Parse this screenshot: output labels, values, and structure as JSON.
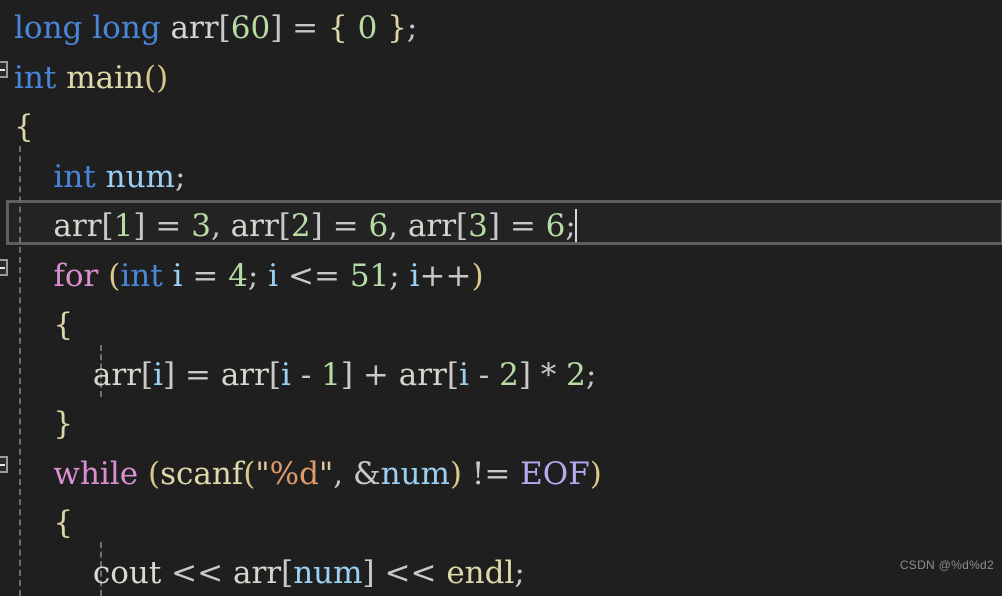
{
  "editor": {
    "theme": "visual-studio-dark",
    "background_color": "#1f1f1f",
    "current_line_border_color": "#5f5f5f",
    "indent_guide_color": "#6e6e6e",
    "caret_color": "#d8d8d8",
    "language": "cpp"
  },
  "watermark": {
    "text": "CSDN @%d%d2"
  },
  "fold_markers": [
    {
      "name": "fold-marker-main",
      "state": "expanded",
      "glyph": "minus"
    },
    {
      "name": "fold-marker-for",
      "state": "expanded",
      "glyph": "minus"
    },
    {
      "name": "fold-marker-while",
      "state": "expanded",
      "glyph": "minus"
    }
  ],
  "code": {
    "lines": [
      {
        "id": "line-1",
        "text": "long long arr[60] = { 0 };",
        "current": false,
        "tokens": [
          {
            "t": "long",
            "c": "t-kw"
          },
          {
            "t": " ",
            "c": "t-plain"
          },
          {
            "t": "long",
            "c": "t-kw"
          },
          {
            "t": " ",
            "c": "t-plain"
          },
          {
            "t": "arr",
            "c": "t-ident"
          },
          {
            "t": "[",
            "c": "t-bracket"
          },
          {
            "t": "60",
            "c": "t-num"
          },
          {
            "t": "]",
            "c": "t-bracket"
          },
          {
            "t": " ",
            "c": "t-plain"
          },
          {
            "t": "=",
            "c": "t-op"
          },
          {
            "t": " ",
            "c": "t-plain"
          },
          {
            "t": "{",
            "c": "t-brace"
          },
          {
            "t": " ",
            "c": "t-plain"
          },
          {
            "t": "0",
            "c": "t-num"
          },
          {
            "t": " ",
            "c": "t-plain"
          },
          {
            "t": "}",
            "c": "t-brace"
          },
          {
            "t": ";",
            "c": "t-punct"
          }
        ]
      },
      {
        "id": "line-2",
        "text": "int main()",
        "current": false,
        "tokens": [
          {
            "t": "int",
            "c": "t-kw"
          },
          {
            "t": " ",
            "c": "t-plain"
          },
          {
            "t": "main",
            "c": "t-func"
          },
          {
            "t": "(",
            "c": "t-paren"
          },
          {
            "t": ")",
            "c": "t-paren"
          }
        ]
      },
      {
        "id": "line-3",
        "text": "{",
        "current": false,
        "tokens": [
          {
            "t": "{",
            "c": "t-brace"
          }
        ]
      },
      {
        "id": "line-4",
        "text": "    int num;",
        "current": false,
        "tokens": [
          {
            "t": "    ",
            "c": "t-plain"
          },
          {
            "t": "int",
            "c": "t-kw"
          },
          {
            "t": " ",
            "c": "t-plain"
          },
          {
            "t": "num",
            "c": "t-var"
          },
          {
            "t": ";",
            "c": "t-punct"
          }
        ]
      },
      {
        "id": "line-5",
        "text": "    arr[1] = 3, arr[2] = 6, arr[3] = 6;",
        "current": true,
        "tokens": [
          {
            "t": "    ",
            "c": "t-plain"
          },
          {
            "t": "arr",
            "c": "t-ident"
          },
          {
            "t": "[",
            "c": "t-bracket"
          },
          {
            "t": "1",
            "c": "t-num"
          },
          {
            "t": "]",
            "c": "t-bracket"
          },
          {
            "t": " ",
            "c": "t-plain"
          },
          {
            "t": "=",
            "c": "t-op"
          },
          {
            "t": " ",
            "c": "t-plain"
          },
          {
            "t": "3",
            "c": "t-num"
          },
          {
            "t": ",",
            "c": "t-punct"
          },
          {
            "t": " ",
            "c": "t-plain"
          },
          {
            "t": "arr",
            "c": "t-ident"
          },
          {
            "t": "[",
            "c": "t-bracket"
          },
          {
            "t": "2",
            "c": "t-num"
          },
          {
            "t": "]",
            "c": "t-bracket"
          },
          {
            "t": " ",
            "c": "t-plain"
          },
          {
            "t": "=",
            "c": "t-op"
          },
          {
            "t": " ",
            "c": "t-plain"
          },
          {
            "t": "6",
            "c": "t-num"
          },
          {
            "t": ",",
            "c": "t-punct"
          },
          {
            "t": " ",
            "c": "t-plain"
          },
          {
            "t": "arr",
            "c": "t-ident"
          },
          {
            "t": "[",
            "c": "t-bracket"
          },
          {
            "t": "3",
            "c": "t-num"
          },
          {
            "t": "]",
            "c": "t-bracket"
          },
          {
            "t": " ",
            "c": "t-plain"
          },
          {
            "t": "=",
            "c": "t-op"
          },
          {
            "t": " ",
            "c": "t-plain"
          },
          {
            "t": "6",
            "c": "t-num"
          },
          {
            "t": ";",
            "c": "t-punct"
          }
        ]
      },
      {
        "id": "line-6",
        "text": "    for (int i = 4; i <= 51; i++)",
        "current": false,
        "tokens": [
          {
            "t": "    ",
            "c": "t-plain"
          },
          {
            "t": "for",
            "c": "t-ctrl"
          },
          {
            "t": " ",
            "c": "t-plain"
          },
          {
            "t": "(",
            "c": "t-paren"
          },
          {
            "t": "int",
            "c": "t-kw"
          },
          {
            "t": " ",
            "c": "t-plain"
          },
          {
            "t": "i",
            "c": "t-var"
          },
          {
            "t": " ",
            "c": "t-plain"
          },
          {
            "t": "=",
            "c": "t-op"
          },
          {
            "t": " ",
            "c": "t-plain"
          },
          {
            "t": "4",
            "c": "t-num"
          },
          {
            "t": ";",
            "c": "t-punct"
          },
          {
            "t": " ",
            "c": "t-plain"
          },
          {
            "t": "i",
            "c": "t-var"
          },
          {
            "t": " ",
            "c": "t-plain"
          },
          {
            "t": "<=",
            "c": "t-op"
          },
          {
            "t": " ",
            "c": "t-plain"
          },
          {
            "t": "51",
            "c": "t-num"
          },
          {
            "t": ";",
            "c": "t-punct"
          },
          {
            "t": " ",
            "c": "t-plain"
          },
          {
            "t": "i",
            "c": "t-var"
          },
          {
            "t": "++",
            "c": "t-op"
          },
          {
            "t": ")",
            "c": "t-paren"
          }
        ]
      },
      {
        "id": "line-7",
        "text": "    {",
        "current": false,
        "tokens": [
          {
            "t": "    ",
            "c": "t-plain"
          },
          {
            "t": "{",
            "c": "t-brace"
          }
        ]
      },
      {
        "id": "line-8",
        "text": "        arr[i] = arr[i - 1] + arr[i - 2] * 2;",
        "current": false,
        "tokens": [
          {
            "t": "        ",
            "c": "t-plain"
          },
          {
            "t": "arr",
            "c": "t-ident"
          },
          {
            "t": "[",
            "c": "t-bracket"
          },
          {
            "t": "i",
            "c": "t-var"
          },
          {
            "t": "]",
            "c": "t-bracket"
          },
          {
            "t": " ",
            "c": "t-plain"
          },
          {
            "t": "=",
            "c": "t-op"
          },
          {
            "t": " ",
            "c": "t-plain"
          },
          {
            "t": "arr",
            "c": "t-ident"
          },
          {
            "t": "[",
            "c": "t-bracket"
          },
          {
            "t": "i",
            "c": "t-var"
          },
          {
            "t": " ",
            "c": "t-plain"
          },
          {
            "t": "-",
            "c": "t-op"
          },
          {
            "t": " ",
            "c": "t-plain"
          },
          {
            "t": "1",
            "c": "t-num"
          },
          {
            "t": "]",
            "c": "t-bracket"
          },
          {
            "t": " ",
            "c": "t-plain"
          },
          {
            "t": "+",
            "c": "t-op"
          },
          {
            "t": " ",
            "c": "t-plain"
          },
          {
            "t": "arr",
            "c": "t-ident"
          },
          {
            "t": "[",
            "c": "t-bracket"
          },
          {
            "t": "i",
            "c": "t-var"
          },
          {
            "t": " ",
            "c": "t-plain"
          },
          {
            "t": "-",
            "c": "t-op"
          },
          {
            "t": " ",
            "c": "t-plain"
          },
          {
            "t": "2",
            "c": "t-num"
          },
          {
            "t": "]",
            "c": "t-bracket"
          },
          {
            "t": " ",
            "c": "t-plain"
          },
          {
            "t": "*",
            "c": "t-op"
          },
          {
            "t": " ",
            "c": "t-plain"
          },
          {
            "t": "2",
            "c": "t-num"
          },
          {
            "t": ";",
            "c": "t-punct"
          }
        ]
      },
      {
        "id": "line-9",
        "text": "    }",
        "current": false,
        "tokens": [
          {
            "t": "    ",
            "c": "t-plain"
          },
          {
            "t": "}",
            "c": "t-brace"
          }
        ]
      },
      {
        "id": "line-10",
        "text": "    while (scanf(\"%d\", &num) != EOF)",
        "current": false,
        "tokens": [
          {
            "t": "    ",
            "c": "t-plain"
          },
          {
            "t": "while",
            "c": "t-ctrl"
          },
          {
            "t": " ",
            "c": "t-plain"
          },
          {
            "t": "(",
            "c": "t-paren"
          },
          {
            "t": "scanf",
            "c": "t-func"
          },
          {
            "t": "(",
            "c": "t-paren"
          },
          {
            "t": "\"",
            "c": "t-quote"
          },
          {
            "t": "%d",
            "c": "t-str"
          },
          {
            "t": "\"",
            "c": "t-quote"
          },
          {
            "t": ",",
            "c": "t-punct"
          },
          {
            "t": " ",
            "c": "t-plain"
          },
          {
            "t": "&",
            "c": "t-op"
          },
          {
            "t": "num",
            "c": "t-var"
          },
          {
            "t": ")",
            "c": "t-paren"
          },
          {
            "t": " ",
            "c": "t-plain"
          },
          {
            "t": "!=",
            "c": "t-op"
          },
          {
            "t": " ",
            "c": "t-plain"
          },
          {
            "t": "EOF",
            "c": "t-macro"
          },
          {
            "t": ")",
            "c": "t-paren"
          }
        ]
      },
      {
        "id": "line-11",
        "text": "    {",
        "current": false,
        "tokens": [
          {
            "t": "    ",
            "c": "t-plain"
          },
          {
            "t": "{",
            "c": "t-brace"
          }
        ]
      },
      {
        "id": "line-12",
        "text": "        cout << arr[num] << endl;",
        "current": false,
        "tokens": [
          {
            "t": "        ",
            "c": "t-plain"
          },
          {
            "t": "cout",
            "c": "t-stdobj"
          },
          {
            "t": " ",
            "c": "t-plain"
          },
          {
            "t": "<<",
            "c": "t-op"
          },
          {
            "t": " ",
            "c": "t-plain"
          },
          {
            "t": "arr",
            "c": "t-ident"
          },
          {
            "t": "[",
            "c": "t-bracket"
          },
          {
            "t": "num",
            "c": "t-var"
          },
          {
            "t": "]",
            "c": "t-bracket"
          },
          {
            "t": " ",
            "c": "t-plain"
          },
          {
            "t": "<<",
            "c": "t-op"
          },
          {
            "t": " ",
            "c": "t-plain"
          },
          {
            "t": "endl",
            "c": "t-endl"
          },
          {
            "t": ";",
            "c": "t-punct"
          }
        ]
      }
    ],
    "caret": {
      "line_id": "line-5",
      "after_text": "arr[1] = 3, arr[2] = 6, arr[3] = 6;"
    }
  }
}
